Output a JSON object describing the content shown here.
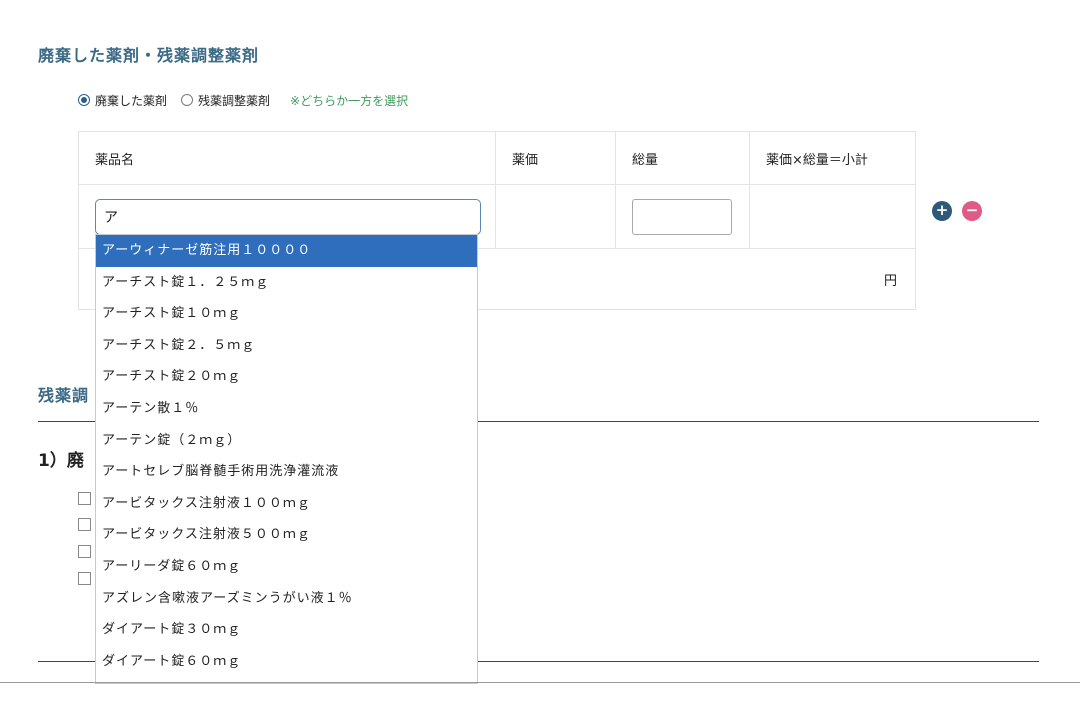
{
  "section": {
    "title": "廃棄した薬剤・残薬調整薬剤",
    "radio_options": [
      "廃棄した薬剤",
      "残薬調整薬剤"
    ],
    "selected_option": "廃棄した薬剤",
    "hint": "※どちらか一方を選択"
  },
  "table": {
    "headers": [
      "薬品名",
      "薬価",
      "総量",
      "薬価×総量＝小計"
    ],
    "drug_name_value": "ア",
    "total_unit": "円"
  },
  "icons": {
    "add": "plus-circle-icon",
    "remove": "minus-circle-icon"
  },
  "background": {
    "section2_title_visible": "残薬調",
    "subsection_visible": "1）廃"
  },
  "dropdown": {
    "items": [
      "アーウィナーゼ筋注用１００００",
      "アーチスト錠１．２５ｍｇ",
      "アーチスト錠１０ｍｇ",
      "アーチスト錠２．５ｍｇ",
      "アーチスト錠２０ｍｇ",
      "アーテン散１％",
      "アーテン錠（２ｍｇ）",
      "アートセレブ脳脊髄手術用洗浄灌流液",
      "アービタックス注射液１００ｍｇ",
      "アービタックス注射液５００ｍｇ",
      "アーリーダ錠６０ｍｇ",
      "アズレン含嗽液アーズミンうがい液１％",
      "ダイアート錠３０ｍｇ",
      "ダイアート錠６０ｍｇ"
    ],
    "active_index": 0
  },
  "colors": {
    "accent": "#3b6a87",
    "hint": "#3f9a5b",
    "highlight": "#2f6ebc",
    "plus": "#2e5a7a",
    "minus": "#e05a86"
  }
}
